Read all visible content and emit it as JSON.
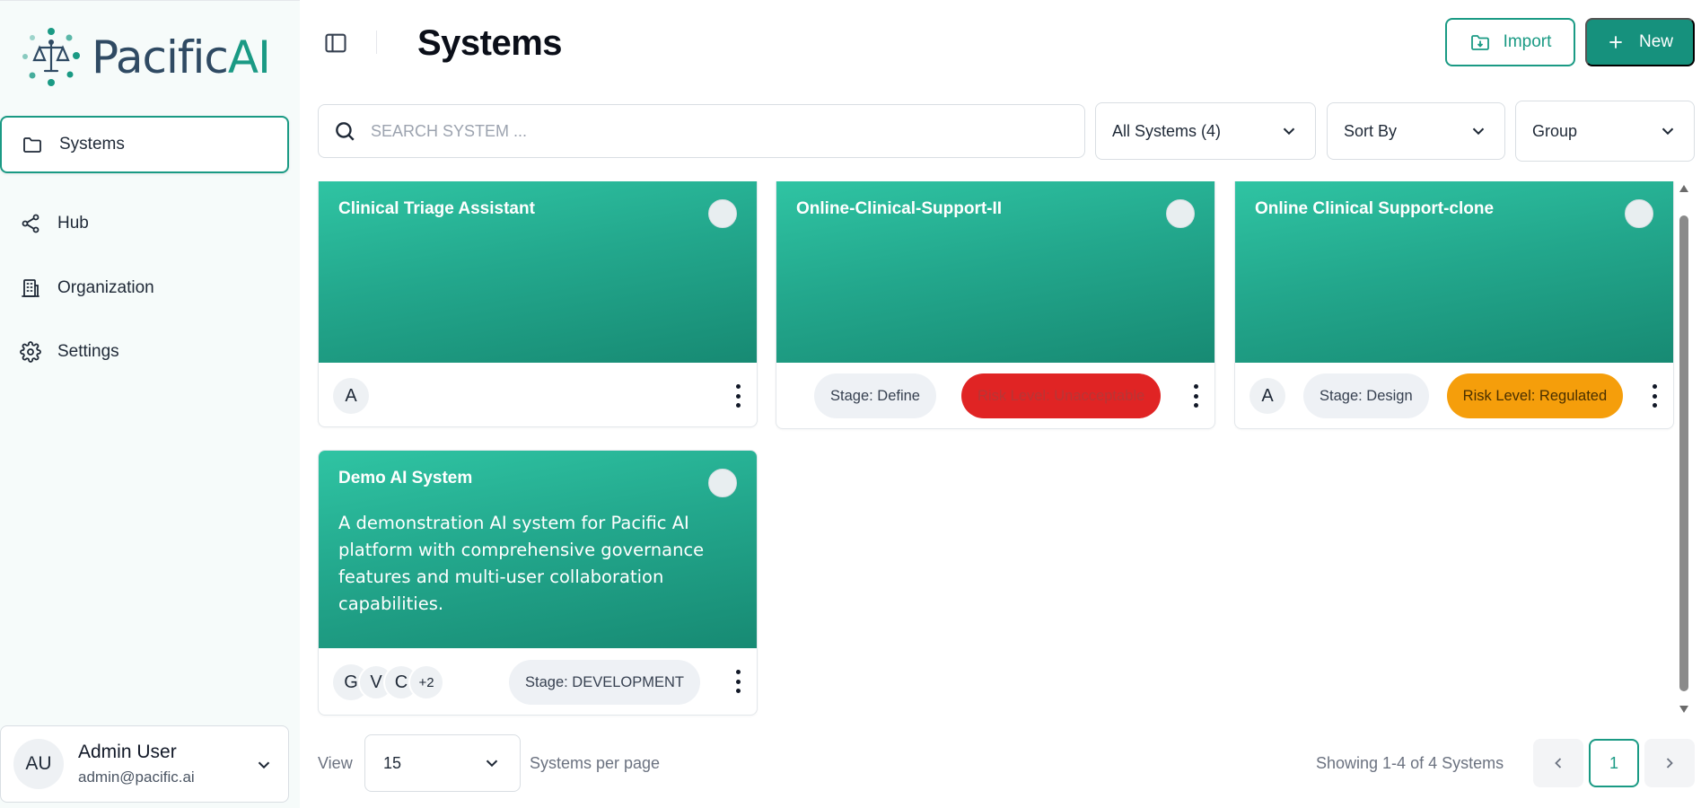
{
  "brand": {
    "name_main": "Pacific",
    "name_accent": "AI",
    "accent_color": "#1a9a84",
    "text_color": "#2f4a63"
  },
  "sidebar": {
    "items": [
      {
        "label": "Systems",
        "icon": "folder-icon",
        "active": true
      },
      {
        "label": "Hub",
        "icon": "share-nodes-icon",
        "active": false
      },
      {
        "label": "Organization",
        "icon": "building-icon",
        "active": false
      },
      {
        "label": "Settings",
        "icon": "gear-icon",
        "active": false
      }
    ],
    "user": {
      "initials": "AU",
      "name": "Admin User",
      "email": "admin@pacific.ai"
    }
  },
  "header": {
    "title": "Systems",
    "import_label": "Import",
    "new_label": "New"
  },
  "filters": {
    "search_placeholder": "SEARCH SYSTEM ...",
    "systems_filter": "All Systems (4)",
    "sort_label": "Sort By",
    "group_label": "Group"
  },
  "cards": [
    {
      "title": "Clinical Triage Assistant",
      "description": "",
      "avatars": [
        "A"
      ],
      "stage": "",
      "risk": ""
    },
    {
      "title": "Online-Clinical-Support-II",
      "description": "",
      "avatars": [],
      "stage": "Stage: Define",
      "risk": "Risk Level: Unacceptable",
      "risk_color": "#e02424"
    },
    {
      "title": "Online Clinical Support-clone",
      "description": "",
      "avatars": [
        "A"
      ],
      "stage": "Stage: Design",
      "risk": "Risk Level: Regulated",
      "risk_color": "#f59e0b"
    },
    {
      "title": "Demo AI System",
      "description": "A demonstration AI system for Pacific AI platform with comprehensive governance features and multi-user collaboration capabilities.",
      "avatars": [
        "G",
        "V",
        "C"
      ],
      "avatar_extra": "+2",
      "stage": "Stage: DEVELOPMENT",
      "risk": ""
    }
  ],
  "footer": {
    "view_label": "View",
    "per_page_value": "15",
    "per_page_label": "Systems per page",
    "showing": "Showing 1-4 of 4 Systems",
    "current_page": "1"
  },
  "colors": {
    "primary": "#16917d",
    "card_gradient_start": "#2fc4a3",
    "card_gradient_end": "#178a73"
  }
}
